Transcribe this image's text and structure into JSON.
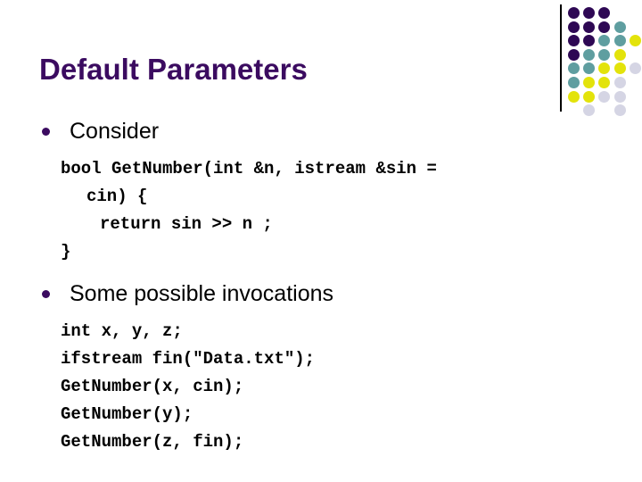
{
  "slide": {
    "title": "Default Parameters",
    "title_color": "#3B0B60",
    "background_color": "#FFFFFF",
    "text_color": "#000000"
  },
  "decoration": {
    "name": "dot-grid",
    "rule_color": "#000000",
    "colors": {
      "purple": "#2E0854",
      "teal": "#5F9EA0",
      "yellow": "#E3E30B",
      "gray": "#D5D5E4"
    },
    "dots": [
      {
        "row": 0,
        "col": 0,
        "color": "#2E0854"
      },
      {
        "row": 0,
        "col": 1,
        "color": "#2E0854"
      },
      {
        "row": 0,
        "col": 2,
        "color": "#2E0854"
      },
      {
        "row": 1,
        "col": 0,
        "color": "#2E0854"
      },
      {
        "row": 1,
        "col": 1,
        "color": "#2E0854"
      },
      {
        "row": 1,
        "col": 2,
        "color": "#2E0854"
      },
      {
        "row": 1,
        "col": 3,
        "color": "#5F9EA0"
      },
      {
        "row": 2,
        "col": 0,
        "color": "#2E0854"
      },
      {
        "row": 2,
        "col": 1,
        "color": "#2E0854"
      },
      {
        "row": 2,
        "col": 2,
        "color": "#5F9EA0"
      },
      {
        "row": 2,
        "col": 3,
        "color": "#5F9EA0"
      },
      {
        "row": 2,
        "col": 4,
        "color": "#E3E30B"
      },
      {
        "row": 3,
        "col": 0,
        "color": "#2E0854"
      },
      {
        "row": 3,
        "col": 1,
        "color": "#5F9EA0"
      },
      {
        "row": 3,
        "col": 2,
        "color": "#5F9EA0"
      },
      {
        "row": 3,
        "col": 3,
        "color": "#E3E30B"
      },
      {
        "row": 4,
        "col": 0,
        "color": "#5F9EA0"
      },
      {
        "row": 4,
        "col": 1,
        "color": "#5F9EA0"
      },
      {
        "row": 4,
        "col": 2,
        "color": "#E3E30B"
      },
      {
        "row": 4,
        "col": 3,
        "color": "#E3E30B"
      },
      {
        "row": 4,
        "col": 4,
        "color": "#D5D5E4"
      },
      {
        "row": 5,
        "col": 0,
        "color": "#5F9EA0"
      },
      {
        "row": 5,
        "col": 1,
        "color": "#E3E30B"
      },
      {
        "row": 5,
        "col": 2,
        "color": "#E3E30B"
      },
      {
        "row": 5,
        "col": 3,
        "color": "#D5D5E4"
      },
      {
        "row": 6,
        "col": 0,
        "color": "#E3E30B"
      },
      {
        "row": 6,
        "col": 1,
        "color": "#E3E30B"
      },
      {
        "row": 6,
        "col": 2,
        "color": "#D5D5E4"
      },
      {
        "row": 6,
        "col": 3,
        "color": "#D5D5E4"
      },
      {
        "row": 7,
        "col": 1,
        "color": "#D5D5E4"
      },
      {
        "row": 7,
        "col": 3,
        "color": "#D5D5E4"
      }
    ]
  },
  "bullets": [
    {
      "label": "Consider",
      "code": [
        {
          "text": "bool GetNumber(int &n, istream &sin =",
          "indent": 0
        },
        {
          "text": "cin) {",
          "indent": 1
        },
        {
          "text": "return sin >> n ;",
          "indent": 2
        },
        {
          "text": "}",
          "indent": 0
        }
      ]
    },
    {
      "label": "Some possible invocations",
      "code": [
        {
          "text": "int x, y, z;",
          "indent": 0
        },
        {
          "text": "ifstream fin(\"Data.txt\");",
          "indent": 0
        },
        {
          "text": "GetNumber(x, cin);",
          "indent": 0
        },
        {
          "text": "GetNumber(y);",
          "indent": 0
        },
        {
          "text": "GetNumber(z, fin);",
          "indent": 0
        }
      ]
    }
  ]
}
